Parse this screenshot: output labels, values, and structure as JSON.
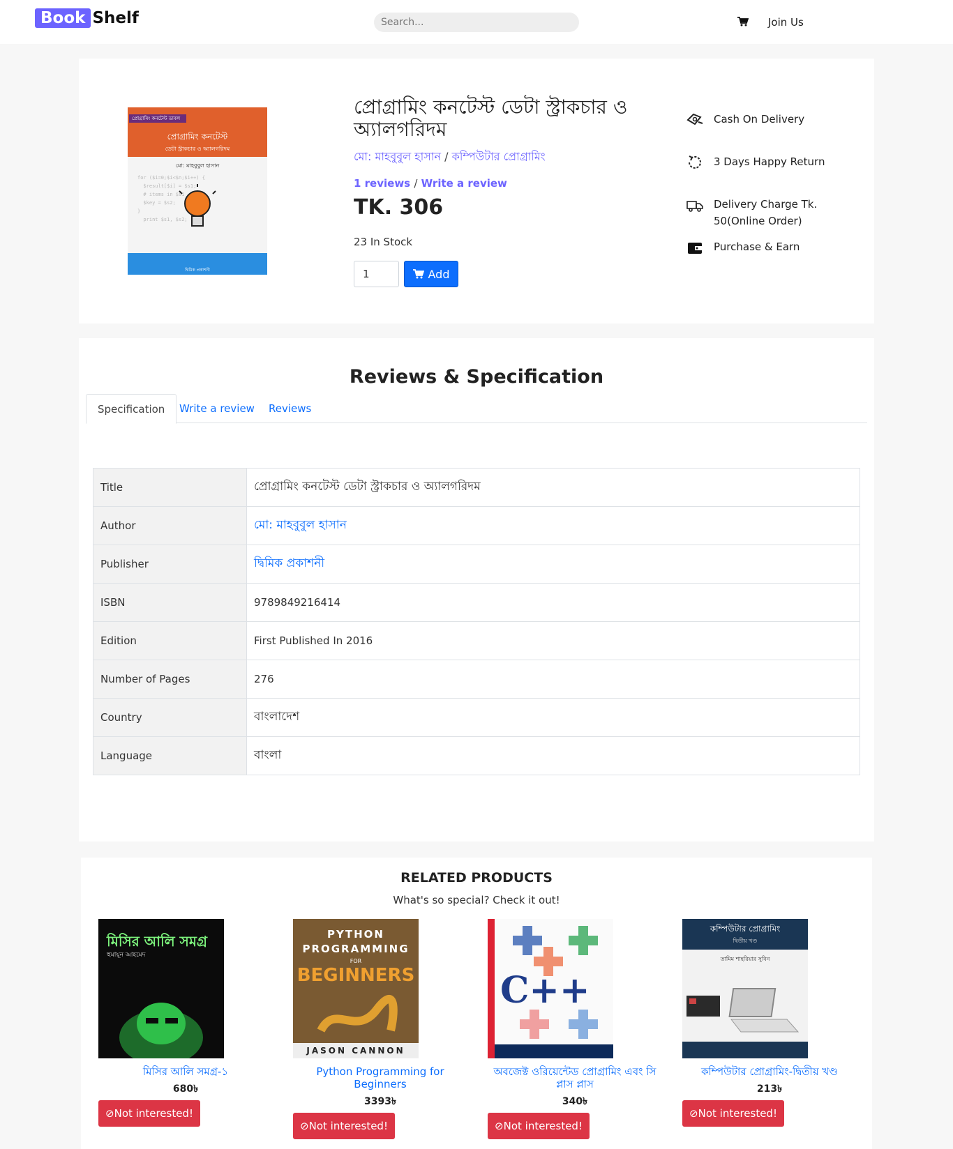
{
  "nav": {
    "brand_part1": "Book",
    "brand_part2": "Shelf",
    "search_placeholder": "Search...",
    "join_label": "Join Us"
  },
  "product": {
    "title": "প্রোগ্রামিং কনটেস্ট ডেটা স্ট্রাকচার ও অ্যালগরিদম",
    "author": "মো: মাহবুবুল হাসান",
    "category": "কম্পিউটার প্রোগ্রামিং",
    "meta_separator": "/",
    "reviews_link": "1 reviews",
    "write_review_link": "Write a review",
    "price": "TK. 306",
    "stock": "23 In Stock",
    "quantity": "1",
    "add_label": "Add",
    "cover": {
      "tag": "প্রোগ্রামিং কনটেস্ট ডাবল",
      "title": "প্রোগ্রামিং কনটেস্ট",
      "subtitle": "ডেটা স্ট্রাকচার ও অ্যালগরিদম",
      "author": "মো: মাহবুবুল হাসান",
      "publisher": "দ্বিমিক প্রকাশনী"
    },
    "features": [
      {
        "icon": "cash-icon",
        "label": "Cash On Delivery"
      },
      {
        "icon": "return-icon",
        "label": "3 Days Happy Return"
      },
      {
        "icon": "truck-icon",
        "label": "Delivery Charge Tk. 50(Online Order)"
      },
      {
        "icon": "wallet-icon",
        "label": "Purchase & Earn"
      }
    ]
  },
  "spec": {
    "heading": "Reviews & Specification",
    "tabs": [
      "Specification",
      "Write a review",
      "Reviews"
    ],
    "rows": [
      {
        "key": "Title",
        "value": "প্রোগ্রামিং কনটেস্ট ডেটা স্ট্রাকচার ও অ্যালগরিদম"
      },
      {
        "key": "Author",
        "value": "মো: মাহবুবুল হাসান"
      },
      {
        "key": "Publisher",
        "value": "দ্বিমিক প্রকাশনী"
      },
      {
        "key": "ISBN",
        "value": "9789849216414"
      },
      {
        "key": "Edition",
        "value": "First Published In 2016"
      },
      {
        "key": "Number of Pages",
        "value": "276"
      },
      {
        "key": "Country",
        "value": "বাংলাদেশ"
      },
      {
        "key": "Language",
        "value": "বাংলা"
      }
    ]
  },
  "related": {
    "heading": "RELATED PRODUCTS",
    "subheading": "What's so special? Check it out!",
    "not_interested_label": "Not interested!",
    "items": [
      {
        "name": "মিসির আলি সমগ্র-১",
        "price": "680৳",
        "cover_title": "মিসির আলি সমগ্র",
        "cover_author": "হুমায়ূন আহমেদ"
      },
      {
        "name": "Python Programming for Beginners",
        "price": "3393৳",
        "cover_title": "PYTHON PROGRAMMING",
        "cover_for": "FOR",
        "cover_big": "BEGINNERS",
        "cover_author": "JASON CANNON"
      },
      {
        "name": "অবজেক্ট ওরিয়েন্টেড প্রোগ্রামিং এবং সি প্লাস প্লাস",
        "price": "340৳",
        "cover_title": "C++"
      },
      {
        "name": "কম্পিউটার প্রোগ্রামিং-দ্বিতীয় খণ্ড",
        "price": "213৳",
        "cover_title": "কম্পিউটার প্রোগ্রামিং",
        "cover_sub": "দ্বিতীয় খণ্ড",
        "cover_author": "তামিম শাহরিয়ার সুবিন"
      }
    ]
  },
  "colors": {
    "brand": "#6c63ff",
    "link": "#0d6efd",
    "danger": "#dc3545"
  }
}
